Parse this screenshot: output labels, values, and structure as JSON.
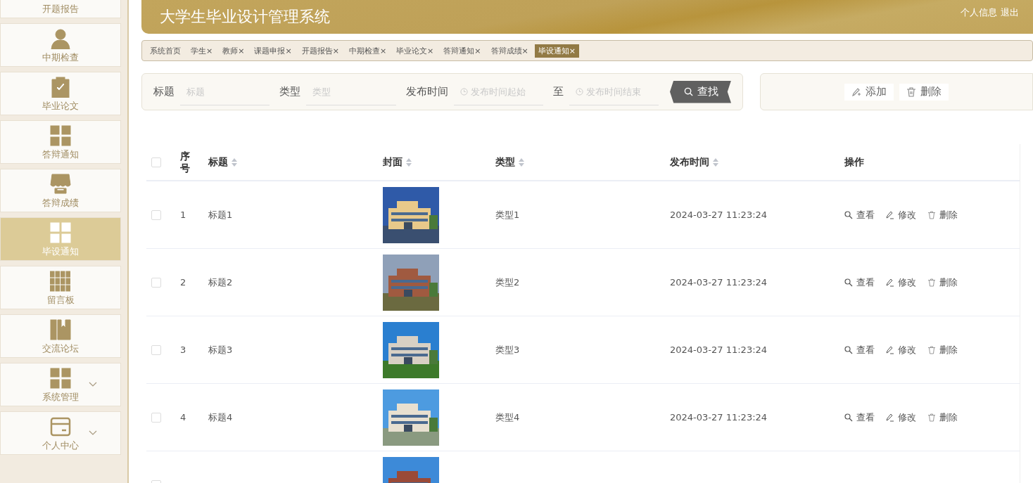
{
  "sidebar": {
    "items": [
      {
        "label": "开题报告",
        "selected": false
      },
      {
        "label": "中期检查",
        "selected": false
      },
      {
        "label": "毕业论文",
        "selected": false
      },
      {
        "label": "答辩通知",
        "selected": false
      },
      {
        "label": "答辩成绩",
        "selected": false
      },
      {
        "label": "毕设通知",
        "selected": true
      },
      {
        "label": "留言板",
        "selected": false
      },
      {
        "label": "交流论坛",
        "selected": false
      },
      {
        "label": "系统管理",
        "selected": false,
        "expandable": true
      },
      {
        "label": "个人中心",
        "selected": false,
        "expandable": true
      }
    ]
  },
  "header": {
    "title": "大学生毕业设计管理系统",
    "links": [
      "个人信息",
      "退出"
    ]
  },
  "tabs": [
    {
      "label": "系统首页",
      "selected": false
    },
    {
      "label": "学生",
      "close": "×",
      "selected": false
    },
    {
      "label": "教师",
      "close": "×",
      "selected": false
    },
    {
      "label": "课题申报",
      "close": "×",
      "selected": false
    },
    {
      "label": "开题报告",
      "close": "×",
      "selected": false
    },
    {
      "label": "中期检查",
      "close": "×",
      "selected": false
    },
    {
      "label": "毕业论文",
      "close": "×",
      "selected": false
    },
    {
      "label": "答辩通知",
      "close": "×",
      "selected": false
    },
    {
      "label": "答辩成绩",
      "close": "×",
      "selected": false
    },
    {
      "label": "毕设通知",
      "close": "×",
      "selected": true
    }
  ],
  "search": {
    "fields": [
      {
        "label": "标题",
        "placeholder": "标题",
        "kind": "text"
      },
      {
        "label": "类型",
        "placeholder": "类型",
        "kind": "text"
      },
      {
        "label": "发布时间",
        "placeholder": "发布时间起始",
        "kind": "date"
      },
      {
        "label": "至",
        "placeholder": "发布时间结束",
        "kind": "date"
      }
    ],
    "button": "查找"
  },
  "actions": [
    "添加",
    "删除"
  ],
  "table": {
    "columns": [
      {
        "label": "序号"
      },
      {
        "label": "标题",
        "sortable": true
      },
      {
        "label": "封面",
        "sortable": true
      },
      {
        "label": "类型",
        "sortable": true
      },
      {
        "label": "发布时间",
        "sortable": true
      },
      {
        "label": "操作"
      }
    ],
    "all_checked": false,
    "rows": [
      {
        "checked": false,
        "index": "1",
        "title": "标题1",
        "cover": {
          "kind": "picture"
        },
        "type": "类型1",
        "time": "2024-03-27 11:23:24",
        "actions": [
          "查看",
          "修改",
          "删除"
        ]
      },
      {
        "checked": false,
        "index": "2",
        "title": "标题2",
        "cover": {
          "kind": "picture"
        },
        "type": "类型2",
        "time": "2024-03-27 11:23:24",
        "actions": [
          "查看",
          "修改",
          "删除"
        ]
      },
      {
        "checked": false,
        "index": "3",
        "title": "标题3",
        "cover": {
          "kind": "picture"
        },
        "type": "类型3",
        "time": "2024-03-27 11:23:24",
        "actions": [
          "查看",
          "修改",
          "删除"
        ]
      },
      {
        "checked": false,
        "index": "4",
        "title": "标题4",
        "cover": {
          "kind": "picture"
        },
        "type": "类型4",
        "time": "2024-03-27 11:23:24",
        "actions": [
          "查看",
          "修改",
          "删除"
        ]
      },
      {
        "checked": false,
        "cover": {
          "kind": "picture"
        }
      }
    ]
  }
}
